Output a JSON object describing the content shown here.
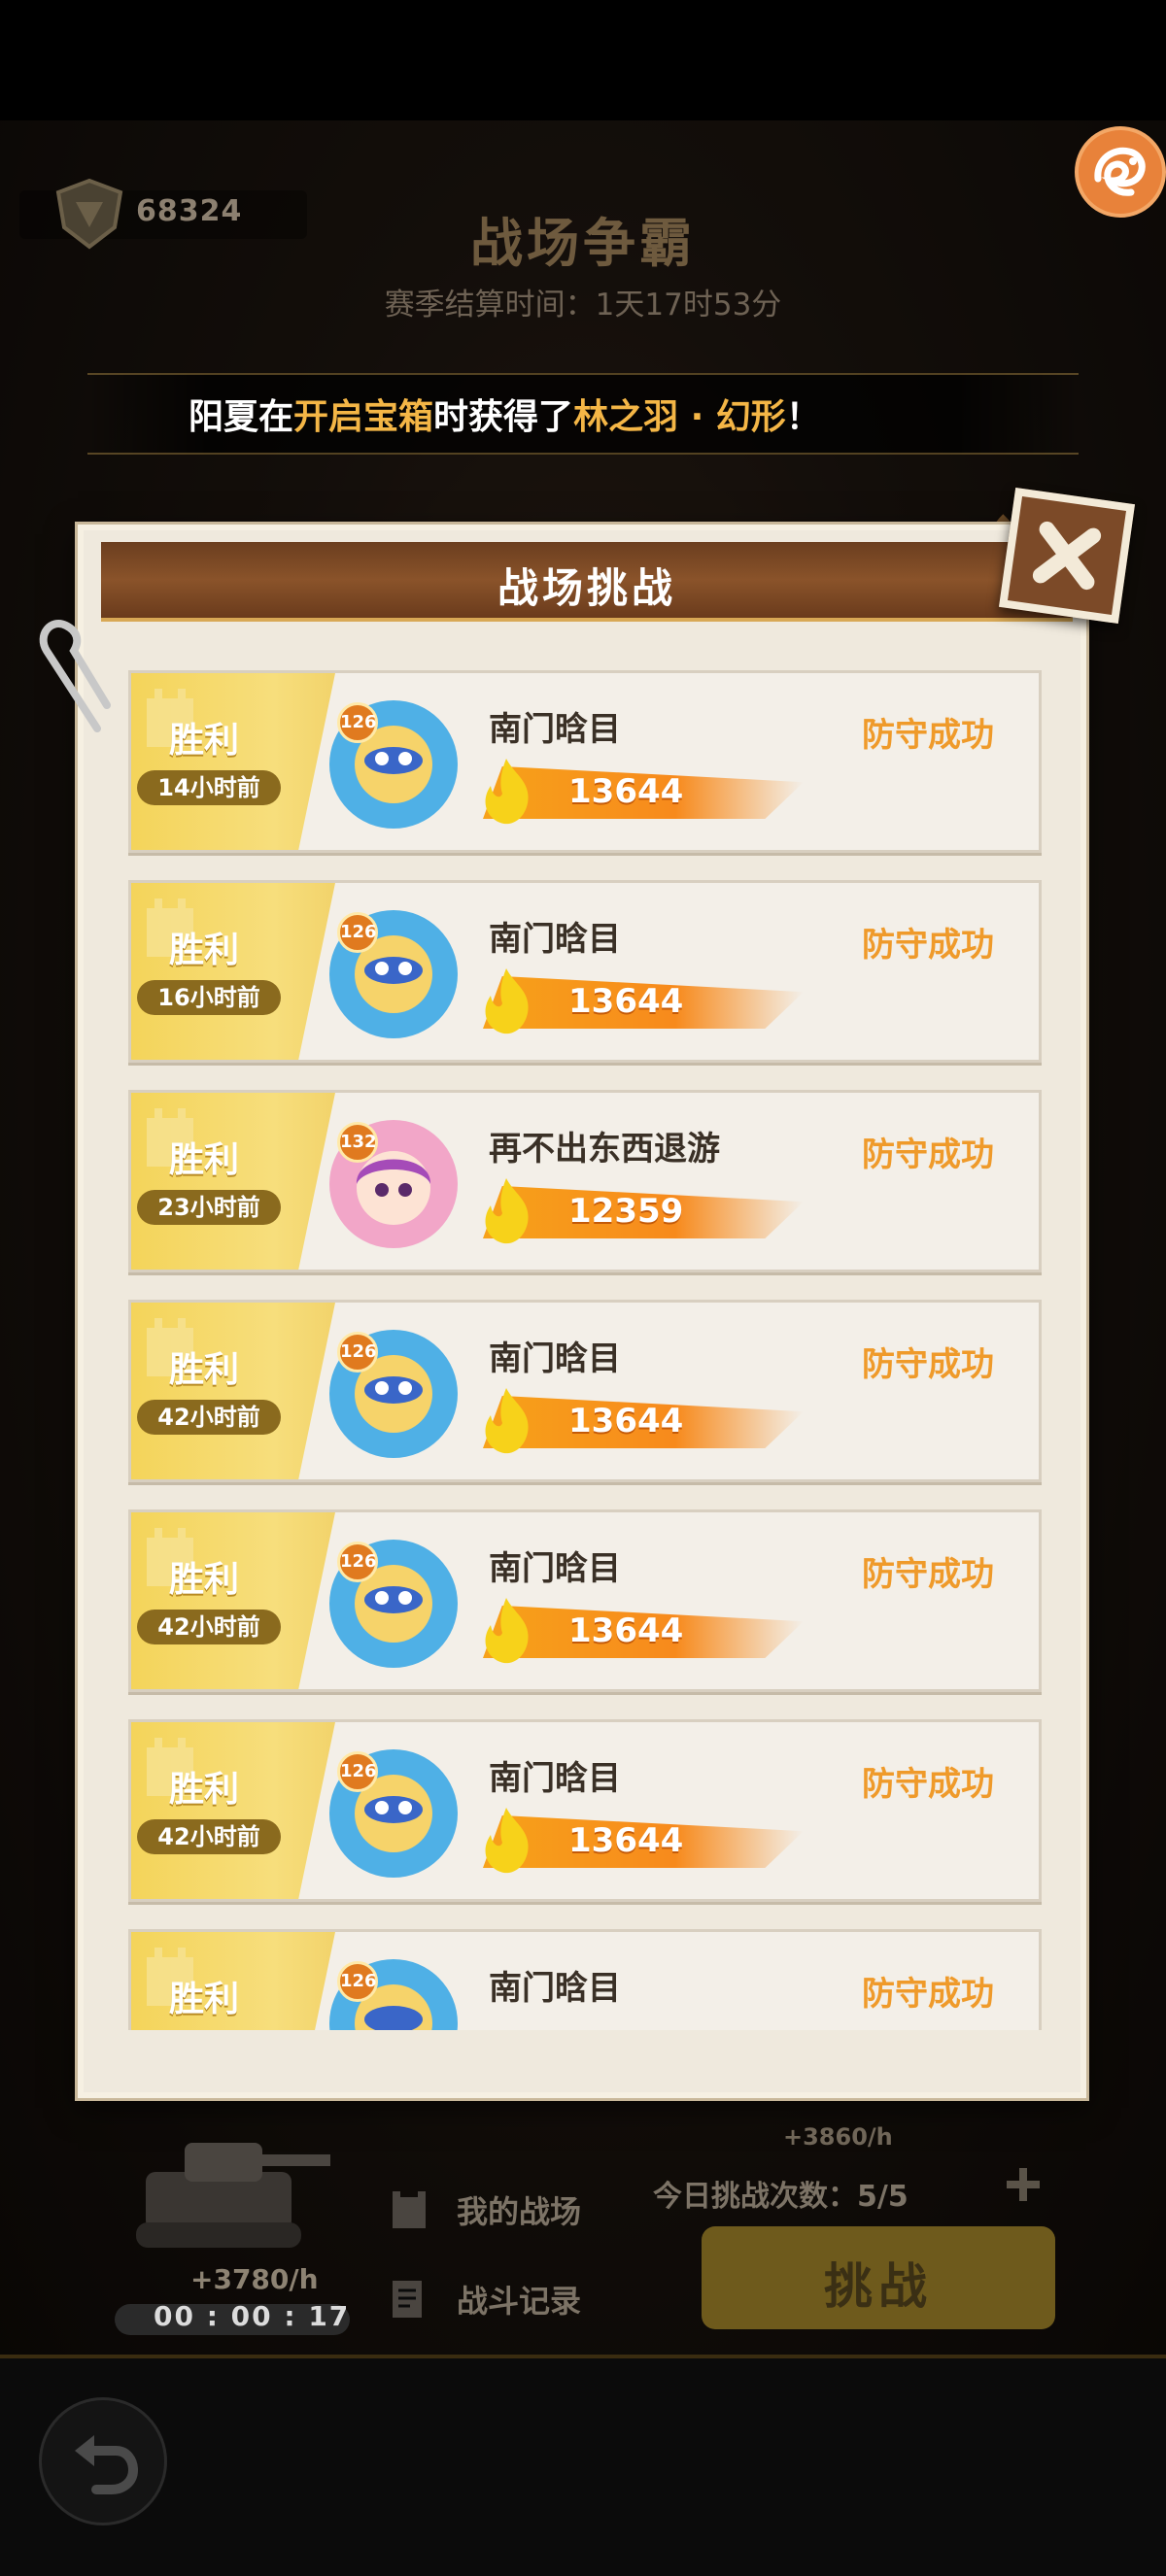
{
  "top_hud": {
    "score": "68324",
    "title": "战场争霸",
    "season_end": "赛季结算时间：1天17时53分"
  },
  "announcement": {
    "player": "阳夏",
    "text_in": "在",
    "action": "开启宝箱",
    "text_got": "时获得了",
    "item": "林之羽 · 幻形",
    "text_end": "！"
  },
  "modal": {
    "title": "战场挑战"
  },
  "records": [
    {
      "result": "胜利",
      "time": "14小时前",
      "level": "126",
      "name": "南门晗目",
      "power": "13644",
      "status": "防守成功"
    },
    {
      "result": "胜利",
      "time": "16小时前",
      "level": "126",
      "name": "南门晗目",
      "power": "13644",
      "status": "防守成功"
    },
    {
      "result": "胜利",
      "time": "23小时前",
      "level": "132",
      "name": "再不出东西退游",
      "power": "12359",
      "status": "防守成功"
    },
    {
      "result": "胜利",
      "time": "42小时前",
      "level": "126",
      "name": "南门晗目",
      "power": "13644",
      "status": "防守成功"
    },
    {
      "result": "胜利",
      "time": "42小时前",
      "level": "126",
      "name": "南门晗目",
      "power": "13644",
      "status": "防守成功"
    },
    {
      "result": "胜利",
      "time": "42小时前",
      "level": "126",
      "name": "南门晗目",
      "power": "13644",
      "status": "防守成功"
    },
    {
      "result": "胜利",
      "time": "",
      "level": "126",
      "name": "南门晗目",
      "power": "",
      "status": "防守成功"
    }
  ],
  "bottom_hud": {
    "rate_left": "+3780/h",
    "timer": "00 : 00 : 17",
    "rate_right": "+3860/h",
    "nav_my_battlefield": "我的战场",
    "nav_battle_log": "战斗记录",
    "daily_count": "今日挑战次数：5/5",
    "challenge_label": "挑战"
  },
  "colors": {
    "accent_orange": "#ef9a2a",
    "result_gold": "#f4d45a",
    "header_brown": "#7a4724"
  }
}
